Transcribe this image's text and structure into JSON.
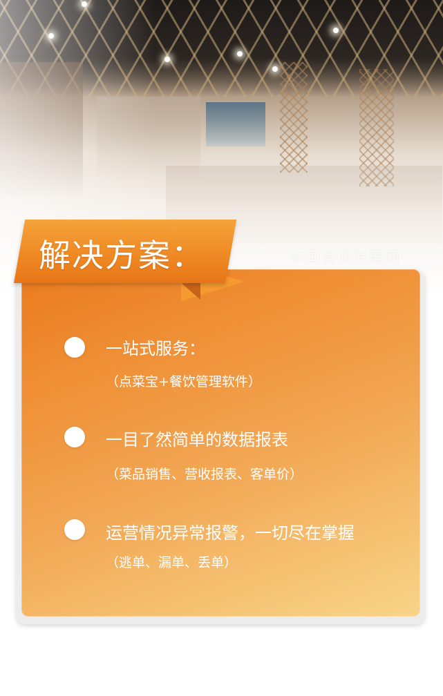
{
  "watermark": "中国食业发展网",
  "heading": "解决方案：",
  "items": [
    {
      "title": "一站式服务：",
      "subtitle": "（点菜宝+餐饮管理软件）"
    },
    {
      "title": "一目了然简单的数据报表",
      "subtitle": "（菜品销售、营收报表、客单价）"
    },
    {
      "title": "运营情况异常报警，一切尽在掌握",
      "subtitle": "（逃单、漏单、丢单）"
    }
  ],
  "colors": {
    "orange_start": "#ea7a1f",
    "orange_end": "#f8d488",
    "ribbon": "#f49a2e"
  }
}
